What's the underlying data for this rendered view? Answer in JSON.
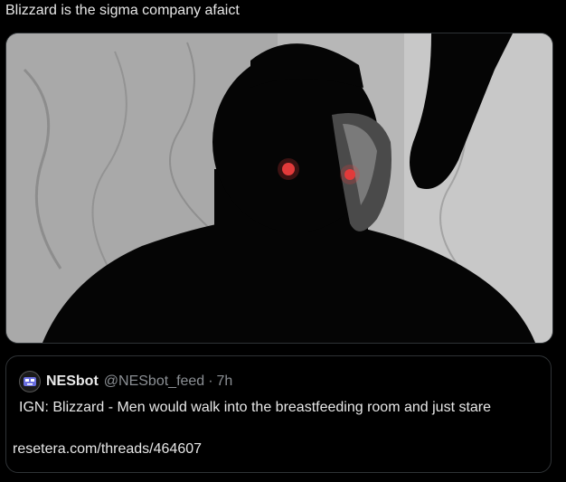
{
  "post": {
    "text": "Blizzard is the sigma company afaict"
  },
  "media": {
    "image": "dark-silhouette-with-red-eyes",
    "eye_color": "#e23a3a"
  },
  "quote": {
    "avatar_icon": "nesbot-avatar-icon",
    "name": "NESbot",
    "handle": "@NESbot_feed",
    "separator": "·",
    "time": "7h",
    "body": "IGN: Blizzard - Men would walk into the breastfeeding room and just stare",
    "link": "resetera.com/threads/464607"
  }
}
